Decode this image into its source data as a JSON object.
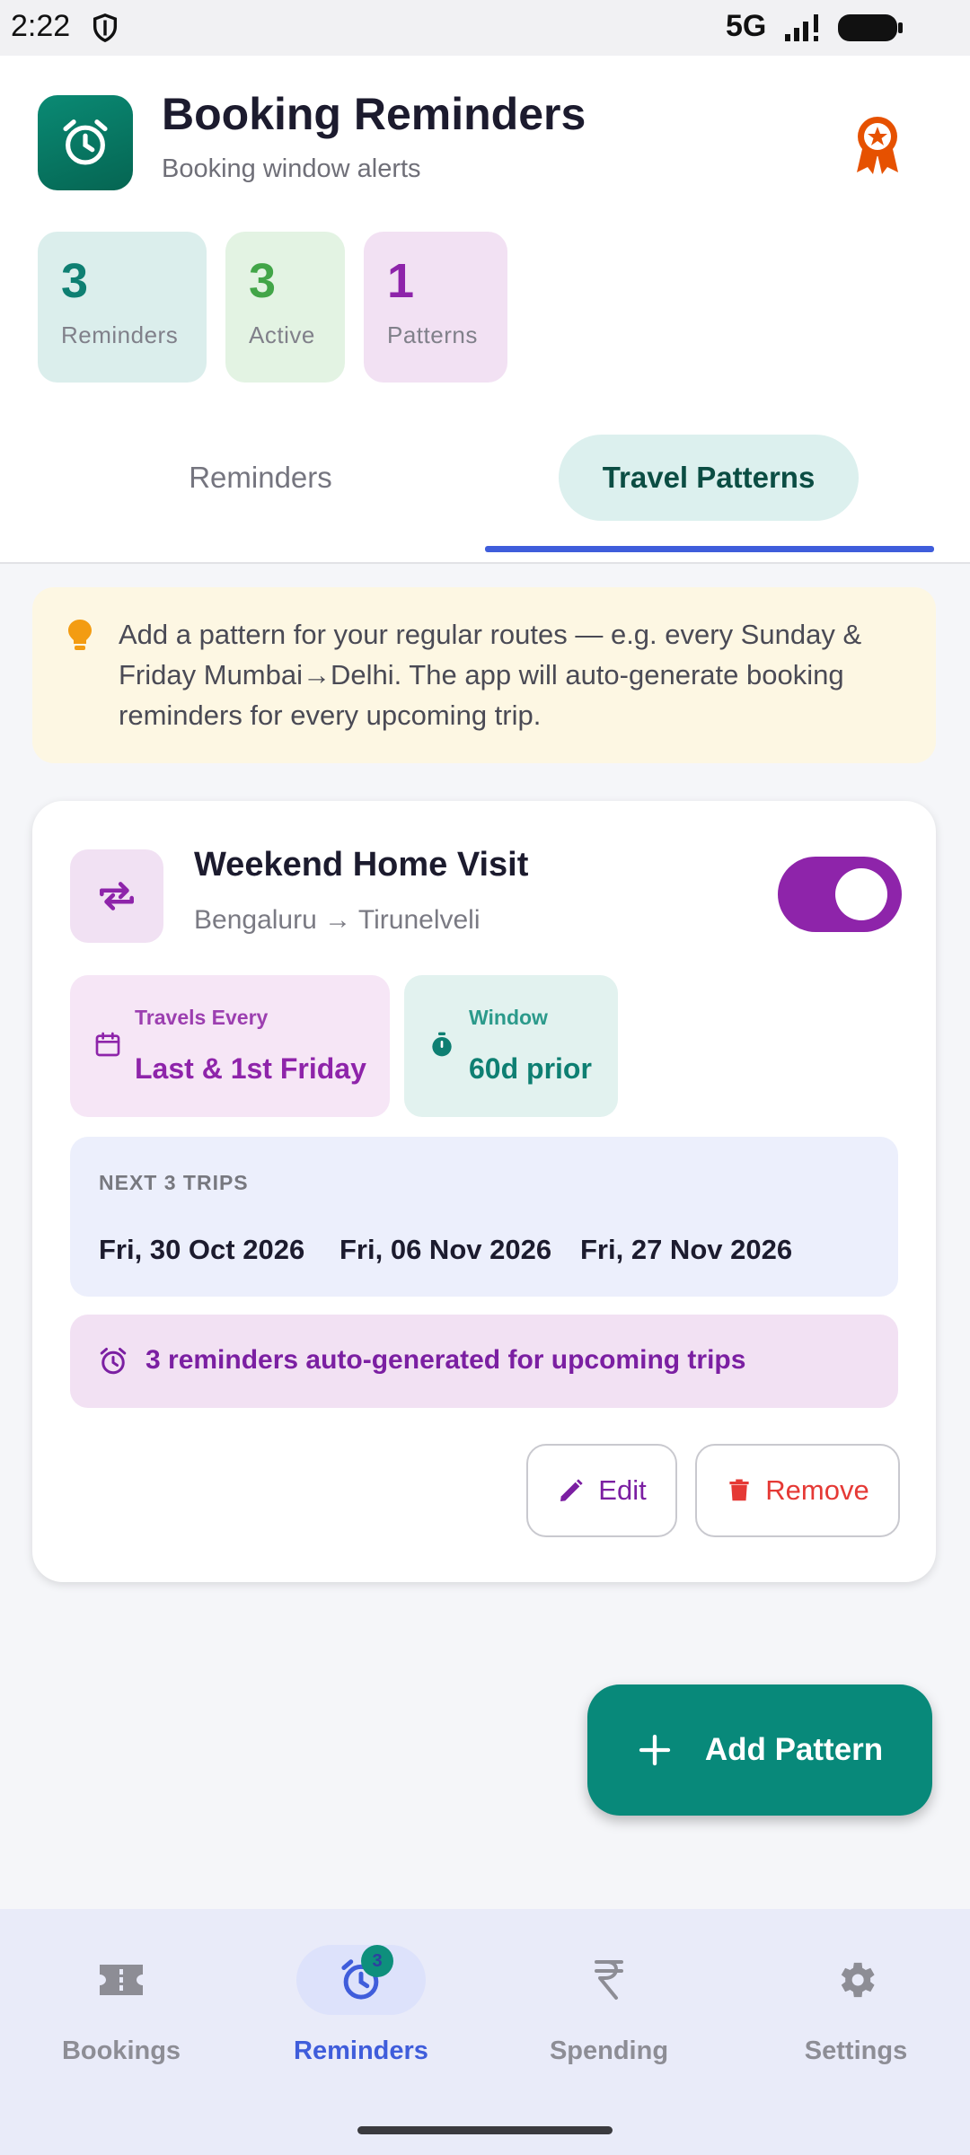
{
  "status_bar": {
    "time": "2:22",
    "network": "5G"
  },
  "header": {
    "title": "Booking Reminders",
    "subtitle": "Booking window alerts"
  },
  "stats": [
    {
      "value": "3",
      "label": "Reminders"
    },
    {
      "value": "3",
      "label": "Active"
    },
    {
      "value": "1",
      "label": "Patterns"
    }
  ],
  "tabs": [
    {
      "label": "Reminders",
      "selected": false
    },
    {
      "label": "Travel Patterns",
      "selected": true
    }
  ],
  "info_banner": {
    "text": "Add a pattern for your regular routes — e.g. every Sunday & Friday Mumbai→Delhi. The app will auto-generate booking reminders for every upcoming trip."
  },
  "pattern": {
    "title": "Weekend Home Visit",
    "route": "Bengaluru → Tirunelveli",
    "enabled": true,
    "travels_every": {
      "label": "Travels Every",
      "value": "Last & 1st Friday"
    },
    "window": {
      "label": "Window",
      "value": "60d prior"
    },
    "next_trips": {
      "label": "NEXT 3 TRIPS",
      "dates": [
        "Fri, 30 Oct 2026",
        "Fri, 06 Nov 2026",
        "Fri, 27 Nov 2026"
      ]
    },
    "autogen_text": "3 reminders auto-generated for upcoming trips",
    "edit_label": "Edit",
    "remove_label": "Remove"
  },
  "fab": {
    "label": "Add Pattern"
  },
  "bottom_nav": {
    "items": [
      {
        "label": "Bookings",
        "icon": "ticket-icon",
        "selected": false
      },
      {
        "label": "Reminders",
        "icon": "alarm-icon",
        "selected": true,
        "badge": "3"
      },
      {
        "label": "Spending",
        "icon": "rupee-icon",
        "selected": false
      },
      {
        "label": "Settings",
        "icon": "gear-icon",
        "selected": false
      }
    ]
  },
  "colors": {
    "accent_teal": "#08897a",
    "accent_purple": "#8e24aa",
    "tab_indicator": "#3f5ddb",
    "remove_red": "#e53935"
  }
}
